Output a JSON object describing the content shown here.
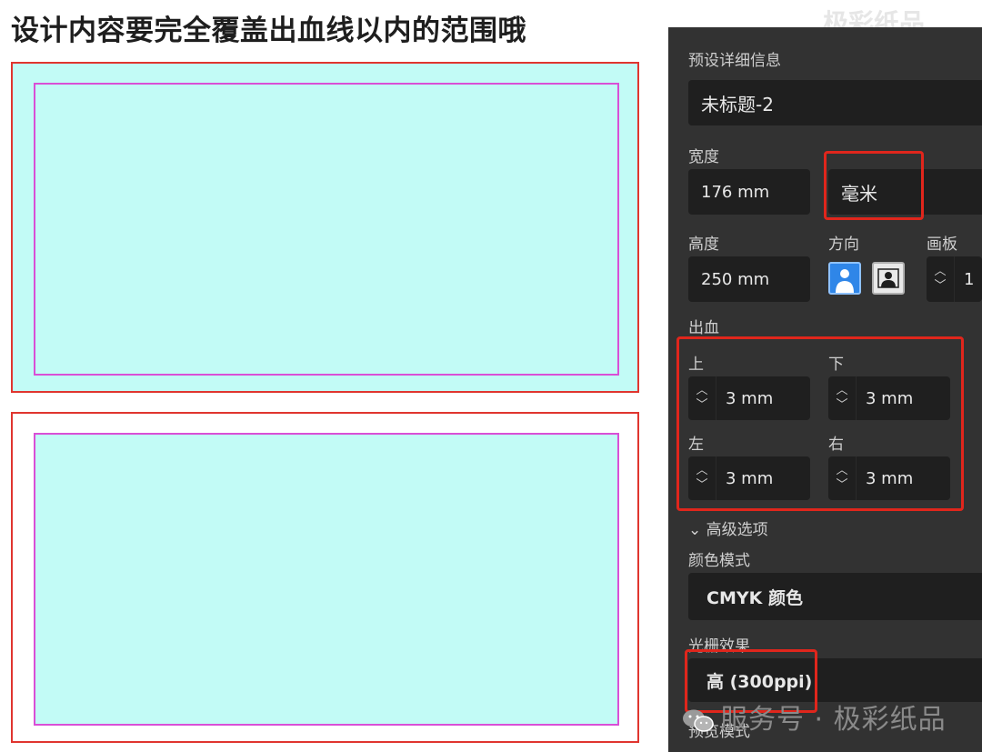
{
  "heading": "设计内容要完全覆盖出血线以内的范围哦",
  "top_watermark": "极彩纸品",
  "panel": {
    "section_title": "预设详细信息",
    "doc_name": "未标题-2",
    "width_label": "宽度",
    "width_value": "176 mm",
    "unit_value": "毫米",
    "height_label": "高度",
    "height_value": "250 mm",
    "orientation_label": "方向",
    "artboard_label": "画板",
    "artboard_value": "1",
    "bleed_label": "出血",
    "bleed": {
      "top_label": "上",
      "top_value": "3 mm",
      "bottom_label": "下",
      "bottom_value": "3 mm",
      "left_label": "左",
      "left_value": "3 mm",
      "right_label": "右",
      "right_value": "3 mm"
    },
    "advanced_label": "高级选项",
    "color_mode_label": "颜色模式",
    "color_mode_value": "CMYK 颜色",
    "raster_label": "光栅效果",
    "raster_value": "高 (300ppi)",
    "preview_label": "预览模式"
  },
  "watermark": "服务号 · 极彩纸品",
  "colors": {
    "bleed_line": "#e0352f",
    "trim_line": "#d94fd6",
    "fill": "#c2fbf6",
    "panel_bg": "#323232",
    "highlight": "#e0261c"
  }
}
